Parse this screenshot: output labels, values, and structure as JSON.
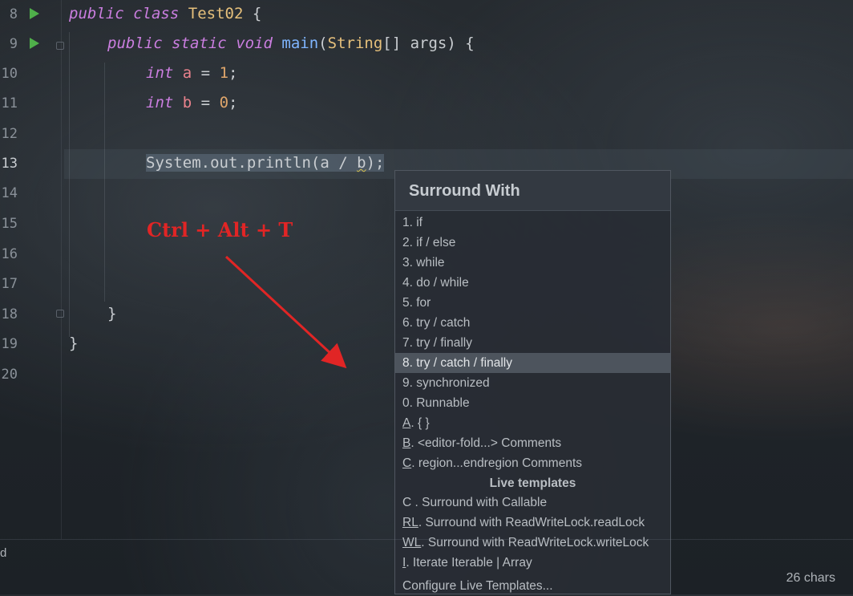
{
  "editor": {
    "line_numbers": [
      "8",
      "9",
      "10",
      "11",
      "12",
      "13",
      "14",
      "15",
      "16",
      "17",
      "18",
      "19",
      "20"
    ],
    "current_line": "13",
    "code": {
      "l8": {
        "kw1": "public",
        "kw2": "class",
        "cls": "Test02",
        "rest": " {"
      },
      "l9": {
        "kw1": "public",
        "kw2": "static",
        "kw3": "void",
        "fn": "main",
        "p1": "(",
        "cls": "String",
        "p2": "[] args) {"
      },
      "l10": {
        "kw": "int",
        "var": "a",
        "eq": " = ",
        "num": "1",
        "end": ";"
      },
      "l11": {
        "kw": "int",
        "var": "b",
        "eq": " = ",
        "num": "0",
        "end": ";"
      },
      "l13": {
        "pre": "System.out.println(a / ",
        "warn": "b",
        "post": ");"
      },
      "l18": "}",
      "l19": "}"
    }
  },
  "annotation": {
    "shortcut": "Ctrl + Alt + T",
    "color": "#e12525"
  },
  "surround_popup": {
    "title": "Surround With",
    "items": [
      {
        "mn": "",
        "label": "1. if"
      },
      {
        "mn": "",
        "label": "2. if / else"
      },
      {
        "mn": "",
        "label": "3. while"
      },
      {
        "mn": "",
        "label": "4. do / while"
      },
      {
        "mn": "",
        "label": "5. for"
      },
      {
        "mn": "",
        "label": "6. try / catch"
      },
      {
        "mn": "",
        "label": "7. try / finally"
      },
      {
        "mn": "",
        "label": "8. try / catch / finally",
        "active": true
      },
      {
        "mn": "",
        "label": "9. synchronized"
      },
      {
        "mn": "",
        "label": "0. Runnable"
      },
      {
        "mn": "A",
        "label": ". { }"
      },
      {
        "mn": "B",
        "label": ". <editor-fold...> Comments"
      },
      {
        "mn": "C",
        "label": ". region...endregion Comments"
      }
    ],
    "live_templates_title": "Live templates",
    "live_templates": [
      {
        "mn": "",
        "label": "C . Surround with Callable"
      },
      {
        "mn": "RL",
        "label": ". Surround with ReadWriteLock.readLock"
      },
      {
        "mn": "WL",
        "label": ". Surround with ReadWriteLock.writeLock"
      },
      {
        "mn": "I",
        "label": ". Iterate Iterable | Array"
      }
    ],
    "configure": "Configure Live Templates..."
  },
  "status": {
    "left": "d",
    "chars": "26 chars"
  },
  "colors": {
    "keyword": "#cb7ee0",
    "class": "#e6c07b",
    "function": "#7fb5ff",
    "number": "#e0a66b",
    "variable": "#e9828c",
    "run_icon": "#4fb04a",
    "popup_highlight": "#4d545d"
  }
}
